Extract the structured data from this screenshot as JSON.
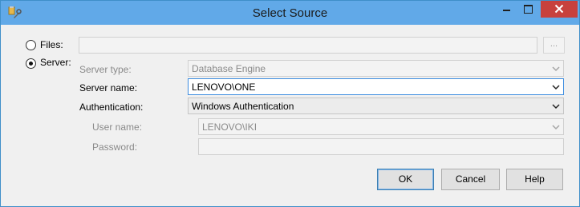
{
  "window": {
    "title": "Select Source"
  },
  "source_type": {
    "files_label": "Files:",
    "server_label": "Server:",
    "selected": "server"
  },
  "files": {
    "path_value": "",
    "browse_label": "..."
  },
  "server": {
    "type_label": "Server type:",
    "type_value": "Database Engine",
    "name_label": "Server name:",
    "name_value": "LENOVO\\ONE",
    "auth_label": "Authentication:",
    "auth_value": "Windows Authentication",
    "username_label": "User name:",
    "username_value": "LENOVO\\IKI",
    "password_label": "Password:",
    "password_value": ""
  },
  "buttons": {
    "ok": "OK",
    "cancel": "Cancel",
    "help": "Help"
  },
  "colors": {
    "titlebar": "#61a9e8",
    "close": "#c7413d",
    "focus_border": "#3e8de0"
  },
  "icons": {
    "app": "wrench-tools-icon",
    "minimize": "minimize-icon",
    "maximize": "maximize-icon",
    "close": "close-icon",
    "dropdown": "chevron-down-icon"
  }
}
